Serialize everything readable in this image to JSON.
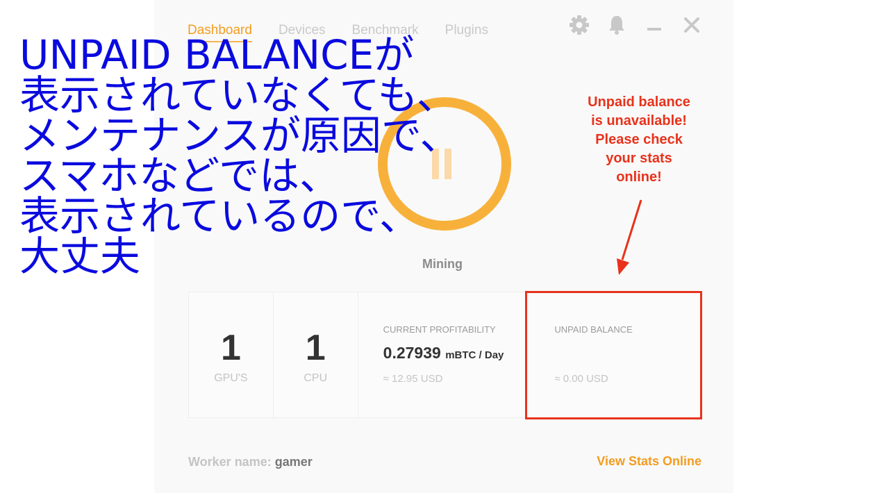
{
  "tabs": [
    {
      "label": "Dashboard",
      "active": true
    },
    {
      "label": "Devices",
      "active": false
    },
    {
      "label": "Benchmark",
      "active": false
    },
    {
      "label": "Plugins",
      "active": false
    }
  ],
  "window_controls": [
    "gear-icon",
    "bell-icon",
    "minimize-icon",
    "close-icon"
  ],
  "status": {
    "label": "Mining",
    "ring_color": "#f7b13b"
  },
  "stats": {
    "gpus": {
      "value": "1",
      "label": "GPU'S"
    },
    "cpus": {
      "value": "1",
      "label": "CPU"
    },
    "profitability": {
      "title": "CURRENT PROFITABILITY",
      "value": "0.27939",
      "unit": "mBTC / Day",
      "approx": "≈ 12.95 USD"
    },
    "unpaid": {
      "title": "UNPAID BALANCE",
      "approx": "≈ 0.00 USD"
    }
  },
  "footer": {
    "worker_label": "Worker name:",
    "worker_name": "gamer",
    "view_stats": "View Stats Online"
  },
  "annotation": {
    "text": "Unpaid balance\nis unavailable!\nPlease check\nyour stats\nonline!",
    "color": "#e8321b"
  },
  "overlay": {
    "lines": [
      "UNPAID BALANCEが",
      "表示されていなくても、",
      "メンテナンスが原因で、",
      "スマホなどでは、",
      "表示されているので、",
      "大丈夫"
    ],
    "color": "#0a0adf"
  },
  "colors": {
    "accent": "#f39c1f",
    "text_muted": "#c4c4c4"
  }
}
